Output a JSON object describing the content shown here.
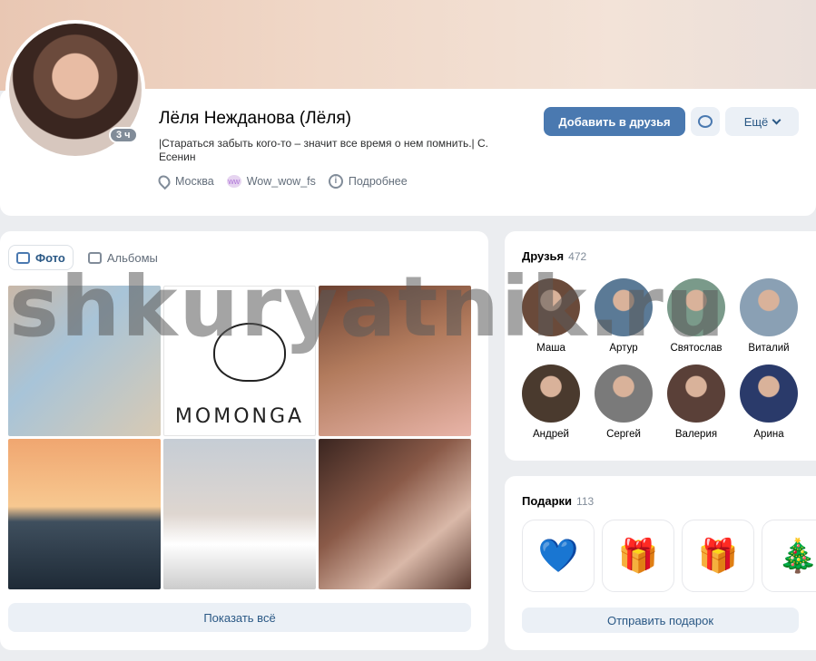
{
  "profile": {
    "name": "Лёля Нежданова (Лёля)",
    "status": "|Стараться забыть кого-то – значит все время о нем помнить.| С. Есенин",
    "last_seen": "3 ч",
    "city": "Москва",
    "community": "Wow_wow_fs",
    "community_icon_text": "ww",
    "more_info": "Подробнее",
    "info_icon_text": "i"
  },
  "actions": {
    "add_friend": "Добавить в друзья",
    "more": "Ещё"
  },
  "photos": {
    "tabs": [
      {
        "label": "Фото",
        "active": true
      },
      {
        "label": "Альбомы",
        "active": false
      }
    ],
    "momonga_text": "MOMONGA",
    "show_all": "Показать всё"
  },
  "friends": {
    "title": "Друзья",
    "count": "472",
    "items": [
      {
        "name": "Маша",
        "color": "#6a4a3a"
      },
      {
        "name": "Артур",
        "color": "#5b7a96"
      },
      {
        "name": "Святослав",
        "color": "#7a9a8a"
      },
      {
        "name": "Виталий",
        "color": "#8aa0b4"
      },
      {
        "name": "Андрей",
        "color": "#4a3a2e"
      },
      {
        "name": "Сергей",
        "color": "#7a7a7a"
      },
      {
        "name": "Валерия",
        "color": "#5a4038"
      },
      {
        "name": "Арина",
        "color": "#2a3a6a"
      }
    ]
  },
  "gifts": {
    "title": "Подарки",
    "count": "113",
    "items": [
      "💙",
      "🎁",
      "🎁",
      "🎄"
    ],
    "send": "Отправить подарок"
  },
  "watermark": "shkuryatnik.ru"
}
